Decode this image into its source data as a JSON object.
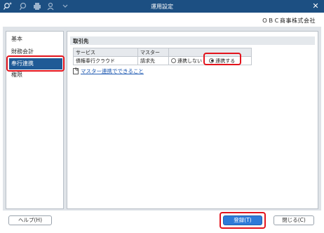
{
  "window": {
    "title": "運用設定",
    "close_glyph": "✕"
  },
  "toolbar": {
    "icons": [
      "new-icon",
      "search-icon",
      "print-icon",
      "user-settings-icon",
      "dropdown-icon"
    ]
  },
  "company": "ＯＢＣ商事株式会社",
  "sidebar": {
    "items": [
      {
        "label": "基本"
      },
      {
        "label": "財務会計"
      },
      {
        "label": "奉行連携"
      },
      {
        "label": "権限"
      }
    ],
    "selected": "奉行連携"
  },
  "section": {
    "title": "取引先"
  },
  "table": {
    "headers": [
      "サービス",
      "マスター",
      ""
    ],
    "rows": [
      {
        "service": "債権奉行クラウド",
        "master": "請求先",
        "option_off": "連携しない",
        "option_on": "連携する",
        "selected": "連携する"
      }
    ]
  },
  "link": {
    "label": "マスター連携でできること"
  },
  "buttons": {
    "help": "ヘルプ(H)",
    "register": "登録(T)",
    "close": "閉じる(C)"
  },
  "colors": {
    "titlebar": "#1c4f82",
    "accent": "#2f7ad8",
    "highlight": "#e3131c"
  }
}
